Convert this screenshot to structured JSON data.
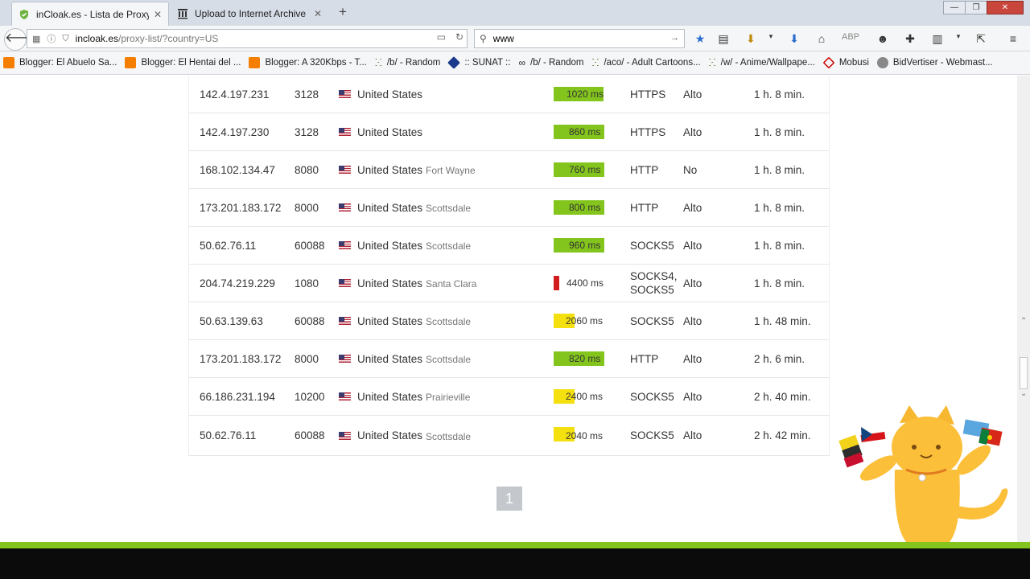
{
  "tabs": [
    {
      "title": "inCloak.es - Lista de Proxys..."
    },
    {
      "title": "Upload to Internet Archive"
    }
  ],
  "address": {
    "domain": "incloak.es",
    "path": "/proxy-list/?country=US"
  },
  "search": {
    "value": "www"
  },
  "bookmarks": [
    {
      "label": "Blogger: El Abuelo Sa...",
      "icon": "blogger-icon"
    },
    {
      "label": "Blogger: El Hentai del ...",
      "icon": "blogger-icon"
    },
    {
      "label": "Blogger: A 320Kbps - T...",
      "icon": "blogger-icon"
    },
    {
      "label": "/b/ - Random",
      "icon": "random-icon"
    },
    {
      "label": ":: SUNAT ::",
      "icon": "sunat-icon"
    },
    {
      "label": "/b/ - Random",
      "icon": "infinity-icon"
    },
    {
      "label": "/aco/ - Adult Cartoons...",
      "icon": "random-icon"
    },
    {
      "label": "/w/ - Anime/Wallpape...",
      "icon": "random-icon"
    },
    {
      "label": "Mobusi",
      "icon": "mobusi-icon"
    },
    {
      "label": "BidVertiser - Webmast...",
      "icon": "bidvertiser-icon"
    }
  ],
  "proxies": [
    {
      "ip": "142.4.197.231",
      "port": "3128",
      "country": "United States",
      "city": "",
      "speed": "1020 ms",
      "speed_ms": 1020,
      "speed_level": "green",
      "type": "HTTPS",
      "anonymity": "Alto",
      "checked": "1 h. 8 min."
    },
    {
      "ip": "142.4.197.230",
      "port": "3128",
      "country": "United States",
      "city": "",
      "speed": "860 ms",
      "speed_ms": 860,
      "speed_level": "green",
      "type": "HTTPS",
      "anonymity": "Alto",
      "checked": "1 h. 8 min."
    },
    {
      "ip": "168.102.134.47",
      "port": "8080",
      "country": "United States",
      "city": "Fort Wayne",
      "speed": "760 ms",
      "speed_ms": 760,
      "speed_level": "green",
      "type": "HTTP",
      "anonymity": "No",
      "checked": "1 h. 8 min."
    },
    {
      "ip": "173.201.183.172",
      "port": "8000",
      "country": "United States",
      "city": "Scottsdale",
      "speed": "800 ms",
      "speed_ms": 800,
      "speed_level": "green",
      "type": "HTTP",
      "anonymity": "Alto",
      "checked": "1 h. 8 min."
    },
    {
      "ip": "50.62.76.11",
      "port": "60088",
      "country": "United States",
      "city": "Scottsdale",
      "speed": "960 ms",
      "speed_ms": 960,
      "speed_level": "green",
      "type": "SOCKS5",
      "anonymity": "Alto",
      "checked": "1 h. 8 min."
    },
    {
      "ip": "204.74.219.229",
      "port": "1080",
      "country": "United States",
      "city": "Santa Clara",
      "speed": "4400 ms",
      "speed_ms": 4400,
      "speed_level": "red",
      "type": "SOCKS4, SOCKS5",
      "anonymity": "Alto",
      "checked": "1 h. 8 min."
    },
    {
      "ip": "50.63.139.63",
      "port": "60088",
      "country": "United States",
      "city": "Scottsdale",
      "speed": "2060 ms",
      "speed_ms": 2060,
      "speed_level": "yellow",
      "type": "SOCKS5",
      "anonymity": "Alto",
      "checked": "1 h. 48 min."
    },
    {
      "ip": "173.201.183.172",
      "port": "8000",
      "country": "United States",
      "city": "Scottsdale",
      "speed": "820 ms",
      "speed_ms": 820,
      "speed_level": "green",
      "type": "HTTP",
      "anonymity": "Alto",
      "checked": "2 h. 6 min."
    },
    {
      "ip": "66.186.231.194",
      "port": "10200",
      "country": "United States",
      "city": "Prairieville",
      "speed": "2400 ms",
      "speed_ms": 2400,
      "speed_level": "yellow",
      "type": "SOCKS5",
      "anonymity": "Alto",
      "checked": "2 h. 40 min."
    },
    {
      "ip": "50.62.76.11",
      "port": "60088",
      "country": "United States",
      "city": "Scottsdale",
      "speed": "2040 ms",
      "speed_ms": 2040,
      "speed_level": "yellow",
      "type": "SOCKS5",
      "anonymity": "Alto",
      "checked": "2 h. 42 min."
    }
  ],
  "pager": {
    "current": "1"
  },
  "colors": {
    "green": "#84c51d",
    "yellow": "#f5e00f",
    "red": "#d11d1d"
  }
}
